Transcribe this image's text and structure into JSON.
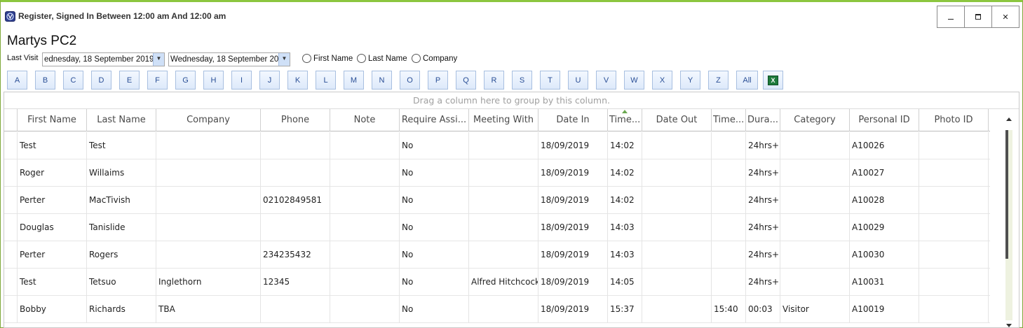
{
  "window": {
    "title": "Register, Signed In Between 12:00 am And 12:00 am",
    "icon": "visitor-app-icon",
    "controls": {
      "minimize_icon": "minimize-icon",
      "maximize_icon": "maximize-icon",
      "close_label": "✕"
    }
  },
  "pc_name": "Martys PC2",
  "filters": {
    "last_visit_label": "Last Visit",
    "date_from": "ednesday, 18 September 2019",
    "date_to": "Wednesday, 18 September 20",
    "radios": [
      {
        "label": "First Name",
        "selected": false
      },
      {
        "label": "Last Name",
        "selected": false
      },
      {
        "label": "Company",
        "selected": false
      }
    ]
  },
  "letters": [
    "A",
    "B",
    "C",
    "D",
    "E",
    "F",
    "G",
    "H",
    "I",
    "J",
    "K",
    "L",
    "M",
    "N",
    "O",
    "P",
    "Q",
    "R",
    "S",
    "T",
    "U",
    "V",
    "W",
    "X",
    "Y",
    "Z",
    "All"
  ],
  "export_icon": "excel-export-icon",
  "grid": {
    "group_panel_text": "Drag a column here to group by this column.",
    "columns": [
      "First Name",
      "Last Name",
      "Company",
      "Phone",
      "Note",
      "Require  Assi...",
      "Meeting With",
      "Date In",
      "Time...",
      "Date Out",
      "Time...",
      "Dura...",
      "Category",
      "Personal ID",
      "Photo ID"
    ],
    "sorted_column_index": 8,
    "rows": [
      [
        "Test",
        "Test",
        "",
        "",
        "",
        "No",
        "",
        "18/09/2019",
        "14:02",
        "",
        "",
        "24hrs+",
        "",
        "A10026",
        ""
      ],
      [
        "Roger",
        "Willaims",
        "",
        "",
        "",
        "No",
        "",
        "18/09/2019",
        "14:02",
        "",
        "",
        "24hrs+",
        "",
        "A10027",
        ""
      ],
      [
        "Perter",
        "MacTivish",
        "",
        "02102849581",
        "",
        "No",
        "",
        "18/09/2019",
        "14:02",
        "",
        "",
        "24hrs+",
        "",
        "A10028",
        ""
      ],
      [
        "Douglas",
        "Tanislide",
        "",
        "",
        "",
        "No",
        "",
        "18/09/2019",
        "14:03",
        "",
        "",
        "24hrs+",
        "",
        "A10029",
        ""
      ],
      [
        "Perter",
        "Rogers",
        "",
        "234235432",
        "",
        "No",
        "",
        "18/09/2019",
        "14:03",
        "",
        "",
        "24hrs+",
        "",
        "A10030",
        ""
      ],
      [
        "Test",
        "Tetsuo",
        "Inglethorn",
        "12345",
        "",
        "No",
        "Alfred Hitchcock",
        "18/09/2019",
        "14:05",
        "",
        "",
        "24hrs+",
        "",
        "A10031",
        ""
      ],
      [
        "Bobby",
        "Richards",
        "TBA",
        "",
        "",
        "No",
        "",
        "18/09/2019",
        "15:37",
        "",
        "15:40",
        "00:03",
        "Visitor",
        "A10019",
        ""
      ]
    ]
  },
  "colors": {
    "window_border": "#8cc63f",
    "letter_text": "#2a4f96",
    "sort_arrow": "#6aa84f"
  }
}
